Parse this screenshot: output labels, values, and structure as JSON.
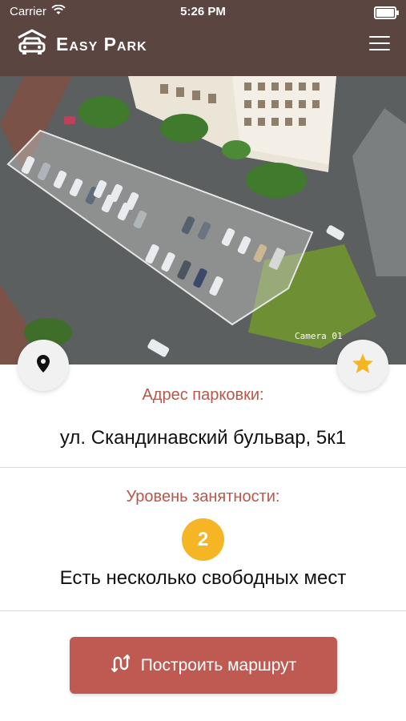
{
  "status_bar": {
    "carrier": "Carrier",
    "time": "5:26 PM"
  },
  "header": {
    "title": "Easy Park"
  },
  "camera": {
    "label": "Camera 01"
  },
  "parking": {
    "address_label": "Адрес парковки:",
    "address": "ул. Скандинавский бульвар, 5к1",
    "occupancy_label": "Уровень занятности:",
    "occupancy_level": "2",
    "occupancy_text": "Есть несколько свободных мест"
  },
  "actions": {
    "route_button": "Построить маршрут"
  },
  "colors": {
    "header_bg": "#5a4540",
    "accent": "#bf5a52",
    "label_color": "#b7574a",
    "badge": "#f5b524"
  },
  "icons": [
    "wifi-icon",
    "battery-icon",
    "car-logo-icon",
    "menu-icon",
    "location-pin-icon",
    "star-icon",
    "route-icon"
  ]
}
